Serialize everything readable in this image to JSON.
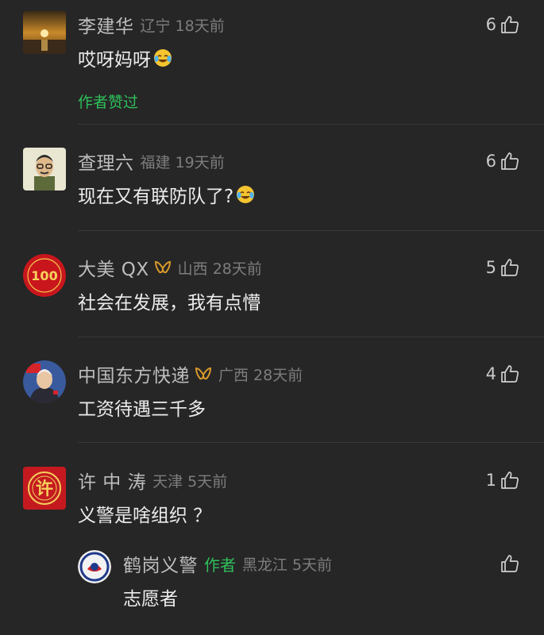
{
  "comments": [
    {
      "name": "李建华",
      "region": "辽宁",
      "time": "18天前",
      "text": "哎呀妈呀",
      "likes": "6",
      "author_liked": "作者赞过"
    },
    {
      "name": "查理六",
      "region": "福建",
      "time": "19天前",
      "text": "现在又有联防队了?",
      "likes": "6"
    },
    {
      "name": "大美 QX",
      "region": "山西",
      "time": "28天前",
      "text": "社会在发展，我有点懵",
      "likes": "5"
    },
    {
      "name": "中国东方快递",
      "region": "广西",
      "time": "28天前",
      "text": "工资待遇三千多",
      "likes": "4"
    },
    {
      "name": "许 中 涛",
      "region": "天津",
      "time": "5天前",
      "text": "义警是啥组织 ？",
      "likes": "1"
    }
  ],
  "reply": {
    "name": "鹤岗义警",
    "author_tag": "作者",
    "region": "黑龙江",
    "time": "5天前",
    "text": "志愿者"
  },
  "avatar_text": {
    "c3": "100",
    "c5": "许"
  },
  "icons": {
    "like": "thumbs-up-icon",
    "badge": "creator-badge-icon",
    "emoji": "laughing-tears-emoji"
  },
  "colors": {
    "background": "#262626",
    "author_green": "#2fbf5c",
    "badge_gold": "#d99a2b"
  }
}
